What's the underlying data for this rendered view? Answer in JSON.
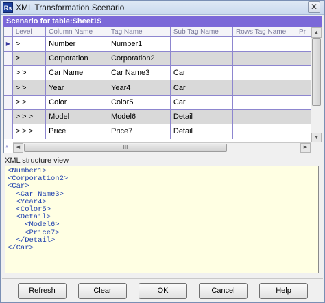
{
  "window": {
    "title": "XML Transformation Scenario",
    "icon_text": "Rs"
  },
  "scenario": {
    "header": "Scenario for table:Sheet1$"
  },
  "grid": {
    "columns": [
      "Level",
      "Column Name",
      "Tag Name",
      "Sub Tag Name",
      "Rows Tag Name",
      "Pr"
    ],
    "rows": [
      {
        "level": ">",
        "column": "Number",
        "tag": "Number1",
        "sub": "",
        "rows_tag": ""
      },
      {
        "level": ">",
        "column": "Corporation",
        "tag": "Corporation2",
        "sub": "",
        "rows_tag": ""
      },
      {
        "level": "> >",
        "column": "Car Name",
        "tag": "Car Name3",
        "sub": "Car",
        "rows_tag": ""
      },
      {
        "level": "> >",
        "column": "Year",
        "tag": "Year4",
        "sub": "Car",
        "rows_tag": ""
      },
      {
        "level": "> >",
        "column": "Color",
        "tag": "Color5",
        "sub": "Car",
        "rows_tag": ""
      },
      {
        "level": "> > >",
        "column": "Model",
        "tag": "Model6",
        "sub": "Detail",
        "rows_tag": ""
      },
      {
        "level": "> > >",
        "column": "Price",
        "tag": "Price7",
        "sub": "Detail",
        "rows_tag": ""
      }
    ],
    "hscroll_grip": "III",
    "new_row_marker": "*"
  },
  "xml_view": {
    "label": "XML structure view",
    "lines": [
      "<Number1>",
      "<Corporation2>",
      "<Car>",
      "  <Car Name3>",
      "  <Year4>",
      "  <Color5>",
      "  <Detail>",
      "    <Model6>",
      "    <Price7>",
      "  </Detail>",
      "</Car>"
    ]
  },
  "buttons": {
    "refresh": "Refresh",
    "clear": "Clear",
    "ok": "OK",
    "cancel": "Cancel",
    "help": "Help"
  },
  "colors": {
    "header_bg": "#7b68d8",
    "grid_line": "#8d86cf",
    "xml_bg": "#ffffe3",
    "xml_text": "#1d3fae",
    "alt_row": "#d9d9d9"
  }
}
